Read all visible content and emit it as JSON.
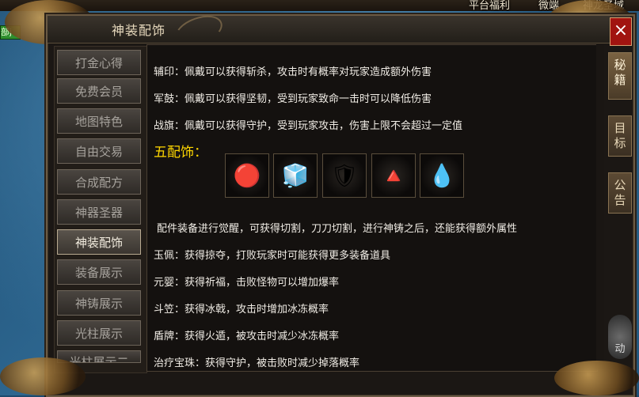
{
  "top_bar": {
    "links": [
      "平台福利",
      "微端",
      "神龙圣域"
    ],
    "badge": "部j"
  },
  "window": {
    "title": "神装配饰",
    "close_label": "×"
  },
  "nav": {
    "items": [
      "打金心得",
      "免费会员",
      "地图特色",
      "自由交易",
      "合成配方",
      "神器圣器",
      "神装配饰",
      "装备展示",
      "神铸展示",
      "光柱展示",
      "光柱展示二"
    ],
    "active_index": 6
  },
  "content": {
    "lines_top": [
      "辅印：佩戴可以获得斩杀，攻击时有概率对玩家造成额外伤害",
      "军鼓：佩戴可以获得坚韧，受到玩家致命一击时可以降低伤害",
      "战旗：佩戴可以获得守护，受到玩家攻击，伤害上限不会超过一定值"
    ],
    "heading": "五配饰：",
    "items": [
      {
        "icon": "red-jewel-icon",
        "glyph": "🔴"
      },
      {
        "icon": "ice-figure-icon",
        "glyph": "🧊"
      },
      {
        "icon": "shield-disc-icon",
        "glyph": "🛡"
      },
      {
        "icon": "golden-pyramid-icon",
        "glyph": "🔺"
      },
      {
        "icon": "blue-gem-icon",
        "glyph": "💧"
      }
    ],
    "lines_bottom": [
      "配件装备进行觉醒，可获得切割，刀刀切割，进行神铸之后，还能获得额外属性",
      "玉佩：获得掠夺，打败玩家时可能获得更多装备道具",
      "元婴：获得祈福，击败怪物可以增加爆率",
      "斗笠：获得冰戟，攻击时增加冰冻概率",
      "盾牌：获得火遁，被攻击时减少冰冻概率",
      "治疗宝珠：获得守护，被击败时减少掉落概率"
    ]
  },
  "side_tabs": [
    {
      "label": "秘籍",
      "active": true
    },
    {
      "label": "目标",
      "active": false
    },
    {
      "label": "公告",
      "active": false
    }
  ],
  "side_bottom": "动",
  "colors": {
    "heading": "#ffd700",
    "close": "#a11410",
    "text": "#f1ede6"
  }
}
